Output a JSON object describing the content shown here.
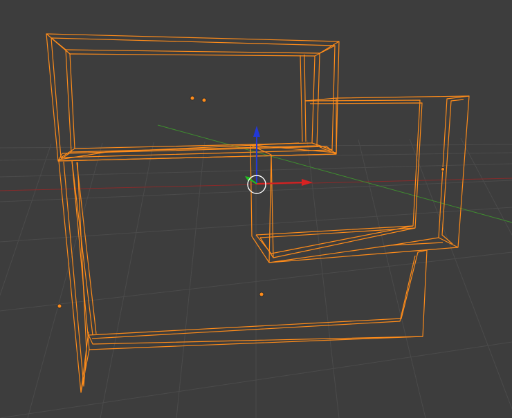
{
  "app": {
    "name": "",
    "view": "3d-viewport"
  },
  "viewport": {
    "background_color": "#3d3d3d",
    "grid_color": "#4a4a4a",
    "grid_accent_color": "#5a5a5a",
    "x_axis_color": "#9b2d2d",
    "y_axis_color": "#3f8f2f",
    "selection_color": "#ff8c1a",
    "gizmo": {
      "x_color": "#d82222",
      "y_color": "#22c022",
      "z_color": "#2238d8",
      "cursor_color": "#ffffff"
    }
  },
  "scene": {
    "selected_object": "wireframe-shelf-model",
    "origin_points_count": 5
  }
}
